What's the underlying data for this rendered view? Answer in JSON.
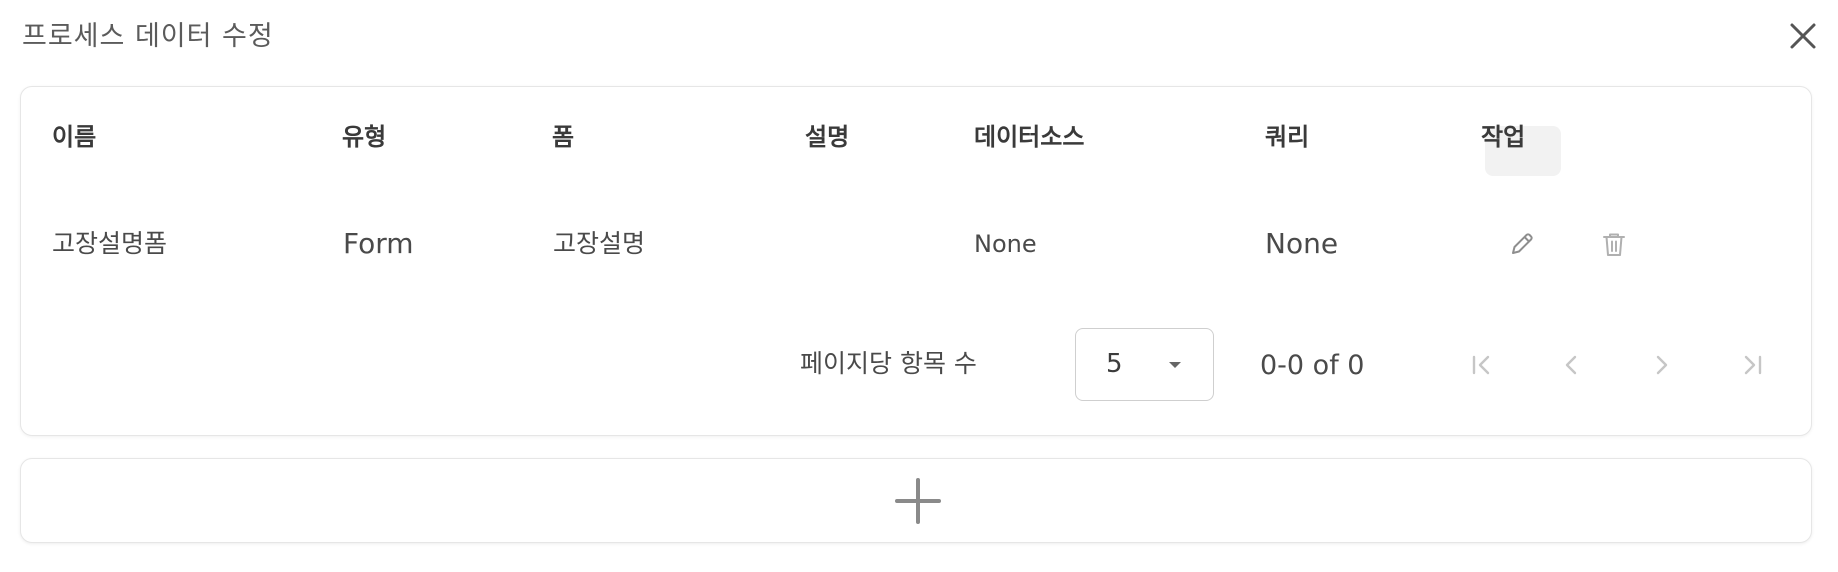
{
  "dialog": {
    "title": "프로세스 데이터 수정",
    "close_icon": "close-icon"
  },
  "table": {
    "columns": [
      "이름",
      "유형",
      "폼",
      "설명",
      "데이터소스",
      "쿼리",
      "작업"
    ],
    "rows": [
      {
        "name": "고장설명폼",
        "type": "Form",
        "form": "고장설명",
        "description": "",
        "datasource": "None",
        "query": "None",
        "actions": [
          "edit-icon",
          "delete-icon"
        ]
      }
    ]
  },
  "pagination": {
    "rows_per_page_label": "페이지당 항목 수",
    "rows_per_page": "5",
    "range": "0-0 of 0",
    "buttons": [
      "first-page-icon",
      "prev-page-icon",
      "next-page-icon",
      "last-page-icon"
    ]
  },
  "add_row": {
    "icon": "plus-icon"
  },
  "colors": {
    "icon": "#9a9a9a",
    "icon_disabled": "#c6c6c6",
    "border": "#e6e6e6"
  }
}
